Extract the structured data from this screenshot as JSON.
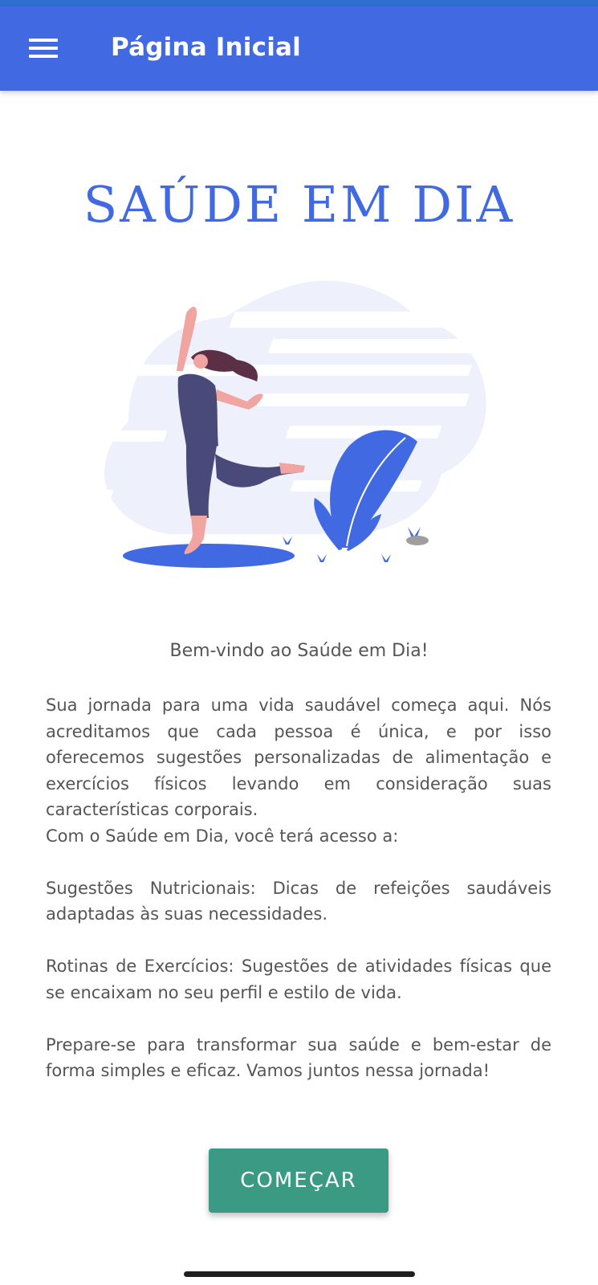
{
  "app_bar": {
    "menu_icon": "hamburger-menu-icon",
    "title": "Página Inicial",
    "color": "#4169e1"
  },
  "brand": {
    "title": "SAÚDE EM DIA",
    "color": "#4169e1"
  },
  "hero": {
    "description": "illustration-woman-dancing"
  },
  "content": {
    "welcome": "Bem-vindo ao Saúde em Dia!",
    "paragraph_intro": "Sua jornada para uma vida saudável começa aqui. Nós acreditamos que cada pessoa é única, e por isso oferecemos sugestões personalizadas de alimentação e exercícios físicos levando em consideração suas características corporais.",
    "paragraph_access": "Com o Saúde em Dia, você terá acesso a:",
    "paragraph_nutrition": "Sugestões Nutricionais: Dicas de refeições saudáveis adaptadas às suas necessidades.",
    "paragraph_exercise": "Rotinas de Exercícios: Sugestões de atividades físicas que se encaixam no seu perfil e estilo de vida.",
    "paragraph_closing": "Prepare-se para transformar sua saúde e bem-estar de forma simples e eficaz. Vamos juntos nessa jornada!"
  },
  "actions": {
    "start_label": "COMEÇAR",
    "start_color": "#3a9a84"
  }
}
